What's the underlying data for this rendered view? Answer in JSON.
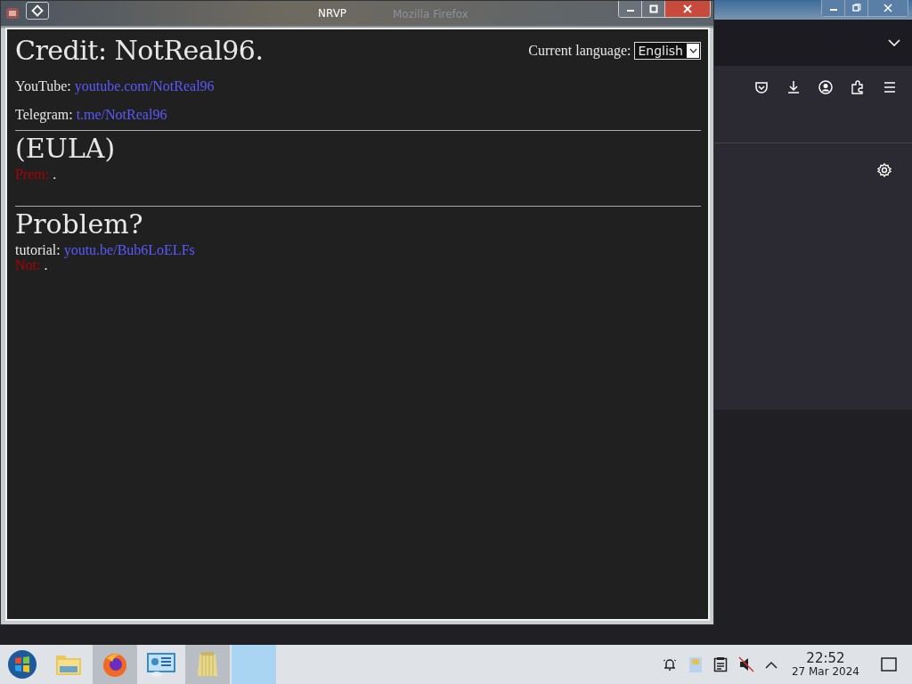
{
  "firefox": {
    "title": "Mozilla Firefox"
  },
  "nrvp_window": {
    "title": "NRVP",
    "heading": "Credit: NotReal96.",
    "language_label": "Current language:",
    "language_select": {
      "value": "English"
    },
    "links": [
      {
        "label": "YouTube:",
        "url": "youtube.com/NotReal96"
      },
      {
        "label": "Telegram:",
        "url": "t.me/NotReal96"
      }
    ],
    "sections": [
      {
        "heading": "(EULA)",
        "lines": [
          {
            "kind": "warning",
            "label": "Prem:",
            "text": "."
          }
        ]
      },
      {
        "heading": "Problem?",
        "lines": [
          {
            "kind": "link",
            "label": "tutorial:",
            "text": "youtu.be/Bub6LoELFs"
          },
          {
            "kind": "warning",
            "label": "Not:",
            "text": "."
          }
        ]
      }
    ]
  },
  "taskbar": {
    "apps": [
      {
        "kind": "start",
        "highlighted": false
      },
      {
        "kind": "folder",
        "highlighted": false
      },
      {
        "kind": "browser",
        "highlighted": true
      },
      {
        "kind": "control",
        "highlighted": false
      },
      {
        "kind": "notes",
        "highlighted": true
      },
      {
        "kind": "blank",
        "highlighted": true
      }
    ],
    "time": "22:52",
    "date": "27 Mar 2024"
  }
}
